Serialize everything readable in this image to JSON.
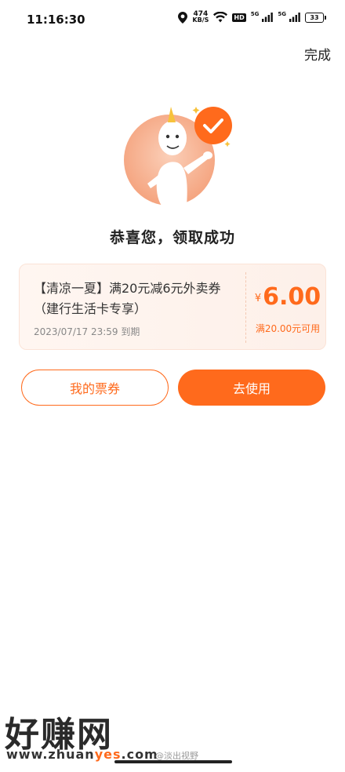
{
  "status_bar": {
    "time": "11:16:30",
    "net_speed_value": "474",
    "net_speed_unit": "KB/S",
    "hd_label": "HD",
    "sig1_label": "5G",
    "sig2_label": "5G",
    "battery": "33",
    "icons": [
      "location-icon",
      "wifi-icon",
      "signal-icon",
      "battery-icon"
    ]
  },
  "header": {
    "done_label": "完成"
  },
  "success": {
    "title": "恭喜您，领取成功"
  },
  "coupon": {
    "title": "【清凉一夏】满20元减6元外卖券（建行生活卡专享）",
    "expiry": "2023/07/17 23:59 到期",
    "currency": "¥",
    "amount": "6.00",
    "condition": "满20.00元可用"
  },
  "actions": {
    "my_tickets_label": "我的票券",
    "use_label": "去使用"
  },
  "watermark": {
    "logo_text": "好赚网",
    "url_prefix": "www.zhuan",
    "url_highlight": "yes",
    "url_suffix": ".com",
    "handle": "@淡出视野"
  },
  "colors": {
    "accent": "#ff6a1c",
    "coupon_bg": "#fdf0e9"
  }
}
